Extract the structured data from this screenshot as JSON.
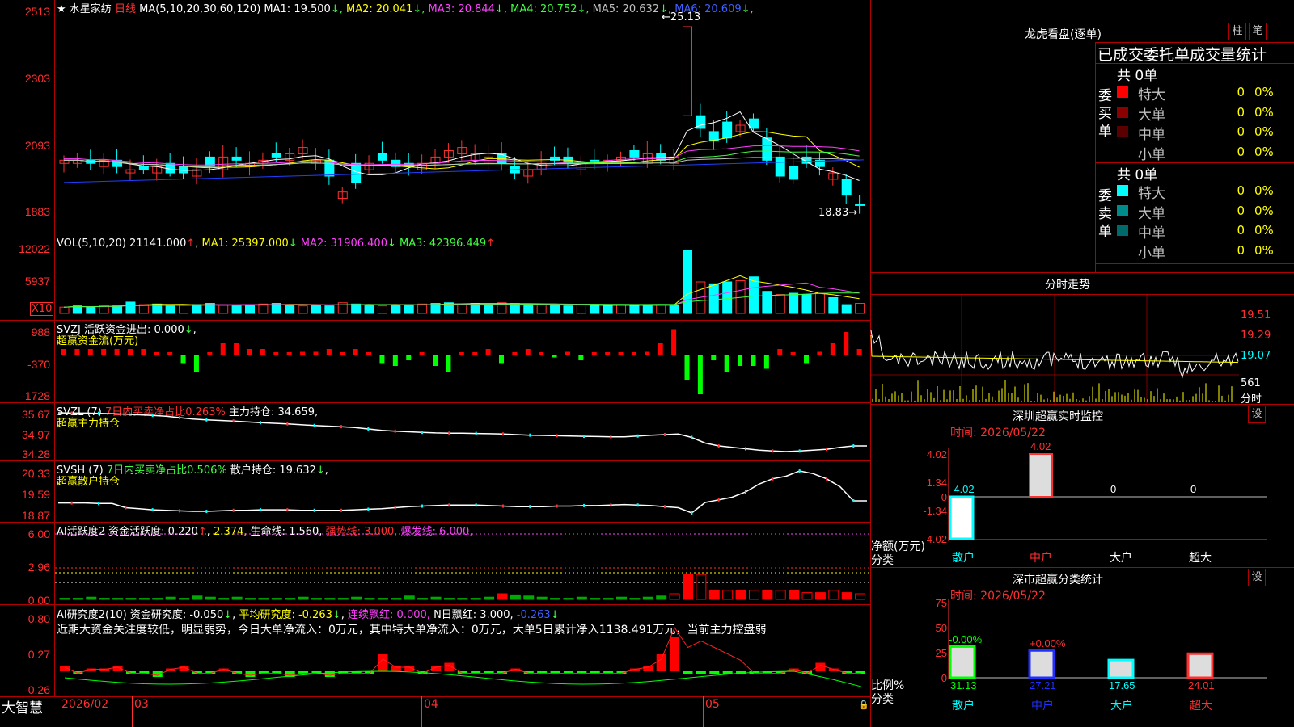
{
  "stock": {
    "name": "水星家纺",
    "period": "日线",
    "ma_label": "MA(5,10,20,30,60,120)",
    "ma": [
      {
        "k": "MA1:",
        "v": "19.500",
        "arrow": "↓",
        "color": "#ffffff"
      },
      {
        "k": "MA2:",
        "v": "20.041",
        "arrow": "↓",
        "color": "#ffff00"
      },
      {
        "k": "MA3:",
        "v": "20.844",
        "arrow": "↓",
        "color": "#ff40ff"
      },
      {
        "k": "MA4:",
        "v": "20.752",
        "arrow": "↓",
        "color": "#40ff40"
      },
      {
        "k": "MA5:",
        "v": "20.632",
        "arrow": "↓",
        "color": "#c0c0c0"
      },
      {
        "k": "MA6:",
        "v": "20.609",
        "arrow": "↓",
        "color": "#4060ff"
      }
    ],
    "high_label": "25.13",
    "low_label": "18.83",
    "price_axis": [
      "2513",
      "2303",
      "2093",
      "1883"
    ]
  },
  "vol": {
    "title": "VOL(5,10,20)",
    "value": "21141.000",
    "ma": [
      {
        "k": "MA1:",
        "v": "25397.000",
        "arrow": "↓",
        "color": "#ffff00"
      },
      {
        "k": "MA2:",
        "v": "31906.400",
        "arrow": "↓",
        "color": "#ff40ff"
      },
      {
        "k": "MA3:",
        "v": "42396.449",
        "arrow": "↑",
        "color": "#40ff40"
      }
    ],
    "axis": [
      "12022",
      "5937"
    ],
    "unit": "X10"
  },
  "svzj": {
    "line1": "SVZJ  活跃资金进出: 0.000",
    "arrow": "↓",
    "line2": "超赢资金流(万元)",
    "axis": [
      "988",
      "-370",
      "-1728"
    ]
  },
  "svzl": {
    "prefix": "SVZL (7)",
    "mid": "7日内买卖净占比0.263%",
    "tail": "主力持仓: 34.659,",
    "line2": "超赢主力持仓",
    "axis": [
      "35.67",
      "34.97",
      "34.28"
    ]
  },
  "svsh": {
    "prefix": "SVSH (7)",
    "mid": "7日内买卖净占比0.506%",
    "tail": "散户持仓: 19.632",
    "arrow": "↓",
    "line2": "超赢散户持仓",
    "axis": [
      "20.33",
      "19.59",
      "18.87"
    ]
  },
  "ai_active": {
    "title": "AI活跃度2",
    "a": "资金活跃度: 0.220",
    "a_arrow": "↑",
    "b": "2.374,",
    "c": "生命线: 1.560,",
    "d": "强势线: 3.000,",
    "e": "爆发线: 6.000,",
    "axis": [
      "6.00",
      "2.96",
      "0.00"
    ]
  },
  "ai_research": {
    "title": "AI研究度2(10)",
    "a": "资金研究度: -0.050",
    "a_arrow": "↓",
    "b": "平均研究度: -0.263",
    "b_arrow": "↓",
    "c": "连续飘红: 0.000,",
    "d": "N日飘红: 3.000,",
    "e": "-0.263",
    "e_arrow": "↓",
    "comment": "近期大资金关注度较低，明显弱势，今日大单净流入：0万元，其中特大单净流入：0万元，大单5日累计净入1138.491万元，当前主力控盘弱",
    "axis": [
      "0.80",
      "0.27",
      "-0.26"
    ]
  },
  "bottom": {
    "brand": "大智慧",
    "dates": [
      "2026/02",
      "03",
      "04",
      "05"
    ]
  },
  "right": {
    "title": "龙虎看盘(逐单)",
    "btn1": "柱",
    "btn2": "笔",
    "header": "已成交委托单成交量统计",
    "buy_label": "委买单",
    "sell_label": "委卖单",
    "buy_total": "共 0单",
    "sell_total": "共 0单",
    "buy_rows": [
      {
        "name": "特大",
        "n": "0",
        "p": "0%",
        "color": "#ff0000"
      },
      {
        "name": "大单",
        "n": "0",
        "p": "0%",
        "color": "#8b0000"
      },
      {
        "name": "中单",
        "n": "0",
        "p": "0%",
        "color": "#5a0000"
      },
      {
        "name": "小单",
        "n": "0",
        "p": "0%",
        "color": "#000000"
      }
    ],
    "sell_rows": [
      {
        "name": "特大",
        "n": "0",
        "p": "0%",
        "color": "#00ffff"
      },
      {
        "name": "大单",
        "n": "0",
        "p": "0%",
        "color": "#008b8b"
      },
      {
        "name": "中单",
        "n": "0",
        "p": "0%",
        "color": "#006a6a"
      },
      {
        "name": "小单",
        "n": "0",
        "p": "0%",
        "color": "#000000"
      }
    ],
    "intraday_title": "分时走势",
    "intraday_axis": [
      "19.51",
      "19.29",
      "19.07"
    ],
    "intraday_vol": "561",
    "intraday_vol_unit": "分时",
    "sz_title": "深圳超赢实时监控",
    "sz_btn": "设",
    "sz_time": "时间: 2026/05/22",
    "sz_axis": [
      "4.02",
      "1.34",
      "0",
      "-1.34",
      "-4.02"
    ],
    "sz_unit1": "净额(万元)",
    "sz_unit2": "分类",
    "sz_values": [
      "-4.02",
      "4.02",
      "0",
      "0"
    ],
    "sz_cats": [
      "散户",
      "中户",
      "大户",
      "超大"
    ],
    "cls_title": "深市超赢分类统计",
    "cls_btn": "设",
    "cls_time": "时间: 2026/05/22",
    "cls_axis": [
      "75",
      "50",
      "25",
      "0"
    ],
    "cls_unit1": "比例%",
    "cls_unit2": "分类",
    "cls_top": [
      "-0.00%",
      "+0.00%"
    ],
    "cls_values": [
      "31.13",
      "27.21",
      "17.65",
      "24.01"
    ],
    "cls_cats": [
      "散户",
      "中户",
      "大户",
      "超大"
    ]
  }
}
